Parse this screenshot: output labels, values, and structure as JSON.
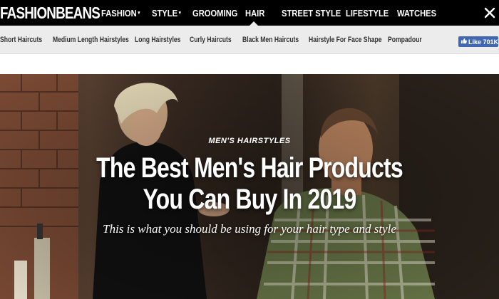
{
  "header": {
    "logo": "FASHIONBEANS",
    "nav": [
      {
        "label": "FASHION",
        "dropdown": true
      },
      {
        "label": "STYLE",
        "dropdown": true
      },
      {
        "label": "GROOMING",
        "dropdown": false
      },
      {
        "label": "HAIR",
        "dropdown": false,
        "active": true
      },
      {
        "label": "STREET STYLE",
        "dropdown": false
      },
      {
        "label": "LIFESTYLE",
        "dropdown": false
      },
      {
        "label": "WATCHES",
        "dropdown": false
      }
    ],
    "close_icon": "close-x-icon",
    "caret_glyph": "▾"
  },
  "subnav": {
    "items": [
      "Short Haircuts",
      "Medium Length Hairstyles",
      "Long Hairstyles",
      "Curly Haircuts",
      "Black Men Haircuts",
      "Hairstyle For Face Shape",
      "Pompadour"
    ],
    "facebook": {
      "label": "Like",
      "count": "701K",
      "icon": "thumbs-up-icon",
      "color": "#4267b2"
    }
  },
  "hero": {
    "category": "MEN'S HAIRSTYLES",
    "title": "The Best Men's Hair Products You Can Buy In 2019",
    "subtitle": "This is what you should be using for your hair type and style"
  }
}
